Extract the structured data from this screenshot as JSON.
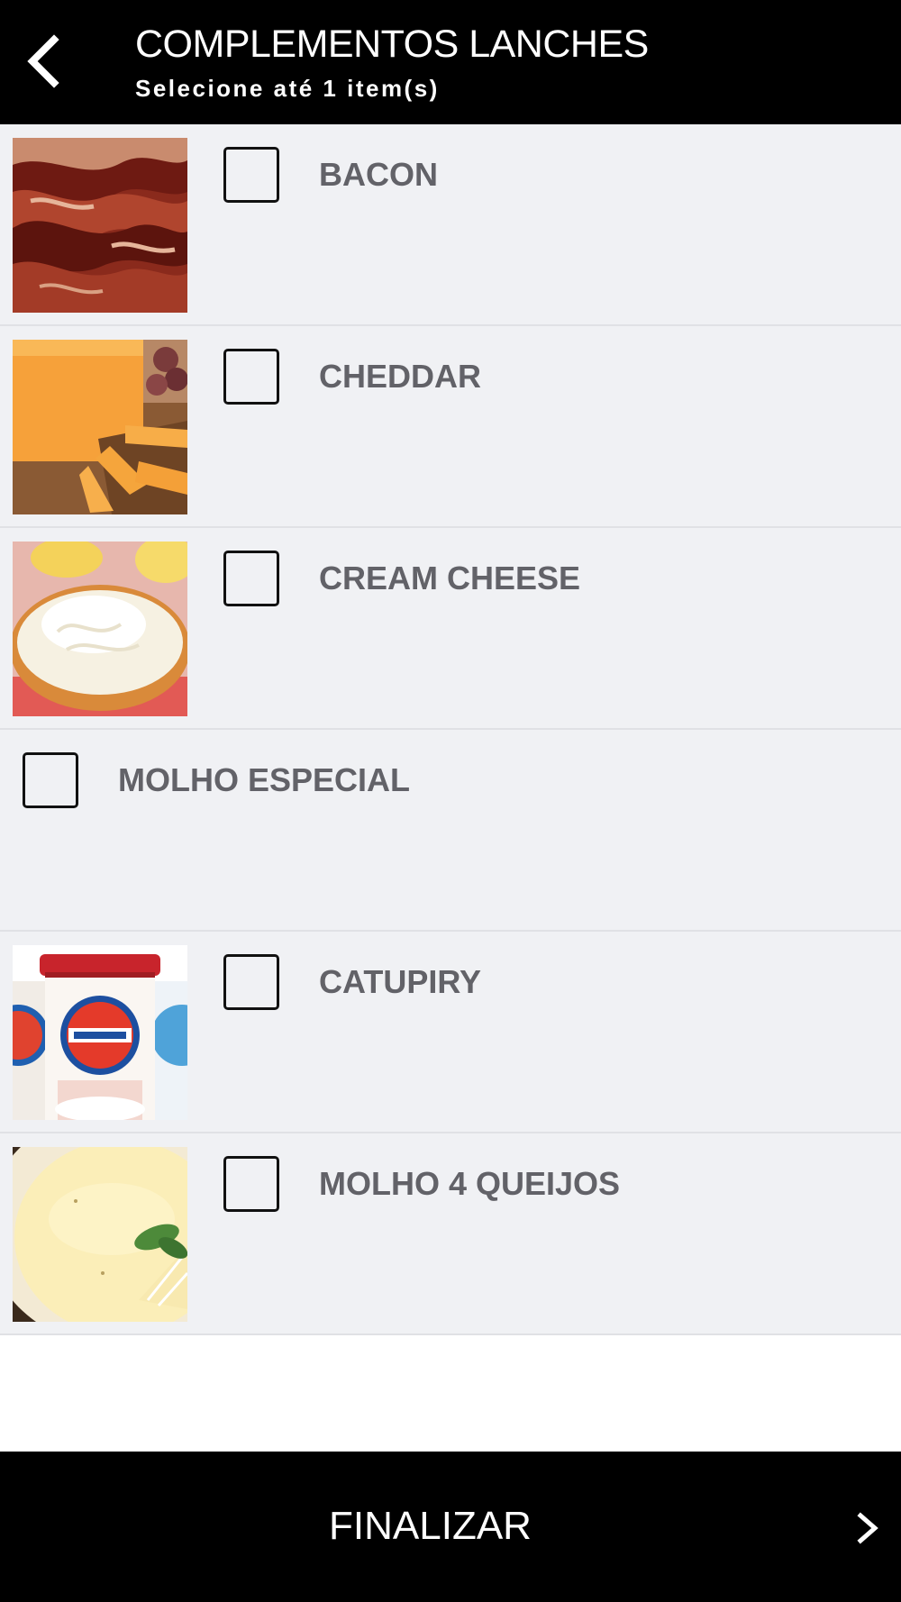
{
  "header": {
    "back_icon": "chevron-left-icon",
    "title": "COMPLEMENTOS LANCHES",
    "subtitle": "Selecione até 1 item(s)"
  },
  "items": [
    {
      "label": "BACON",
      "has_image": true,
      "image": "bacon-photo",
      "checked": false
    },
    {
      "label": "CHEDDAR",
      "has_image": true,
      "image": "cheddar-photo",
      "checked": false
    },
    {
      "label": "CREAM CHEESE",
      "has_image": true,
      "image": "cream-cheese-photo",
      "checked": false
    },
    {
      "label": "MOLHO ESPECIAL",
      "has_image": false,
      "checked": false
    },
    {
      "label": "CATUPIRY",
      "has_image": true,
      "image": "catupiry-photo",
      "checked": false
    },
    {
      "label": "MOLHO 4 QUEIJOS",
      "has_image": true,
      "image": "molho-4-queijos-photo",
      "checked": false
    }
  ],
  "footer": {
    "label": "FINALIZAR",
    "icon": "chevron-right-icon"
  },
  "colors": {
    "header_bg": "#000000",
    "row_bg": "#f0f1f4",
    "row_divider": "#e0e1e5",
    "label_text": "#626268",
    "footer_bg": "#000000"
  }
}
